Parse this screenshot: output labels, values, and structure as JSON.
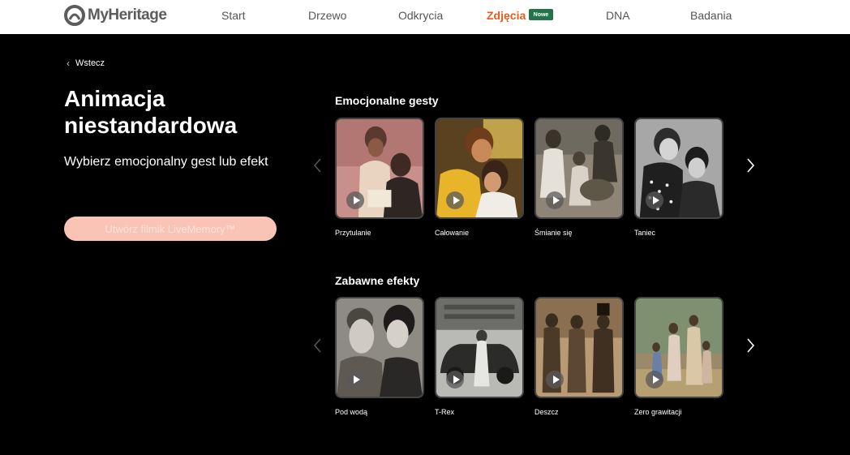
{
  "brand": {
    "name": "MyHeritage"
  },
  "nav": {
    "items": [
      {
        "label": "Start"
      },
      {
        "label": "Drzewo"
      },
      {
        "label": "Odkrycia"
      },
      {
        "label": "Zdjęcia"
      },
      {
        "label": "DNA"
      },
      {
        "label": "Badania"
      }
    ],
    "badge": "Nowe"
  },
  "back": {
    "label": "Wstecz"
  },
  "page": {
    "title": "Animacja niestandardowa",
    "subtitle": "Wybierz emocjonalny gest lub efekt",
    "create_button": "Utwórz filmik LiveMemory™"
  },
  "sections": [
    {
      "title": "Emocjonalne gesty",
      "items": [
        {
          "label": "Przytulanie"
        },
        {
          "label": "Całowanie"
        },
        {
          "label": "Śmianie się"
        },
        {
          "label": "Taniec"
        }
      ]
    },
    {
      "title": "Zabawne efekty",
      "items": [
        {
          "label": "Pod wodą"
        },
        {
          "label": "T-Rex"
        },
        {
          "label": "Deszcz"
        },
        {
          "label": "Zero grawitacji"
        }
      ]
    }
  ],
  "colors": {
    "accent": "#e85a1d",
    "badge": "#23744a",
    "button": "#f9c3b5"
  },
  "icons": {
    "back": "chevron-left-icon",
    "prev": "chevron-left-icon",
    "next": "chevron-right-icon",
    "play": "play-icon"
  }
}
